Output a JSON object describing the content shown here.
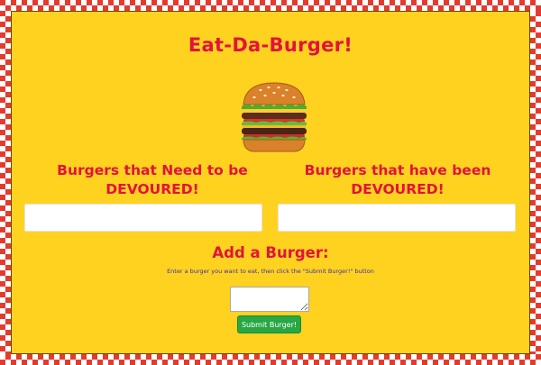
{
  "header": {
    "title": "Eat-Da-Burger!"
  },
  "image": {
    "icon": "burger-icon"
  },
  "columns": {
    "undevoured_heading": "Burgers that Need to be DEVOURED!",
    "devoured_heading": "Burgers that have been DEVOURED!"
  },
  "add_burger": {
    "heading": "Add a Burger:",
    "instructions": "Enter a burger you want to eat, then click the \"Submit Burger!\" button",
    "input_value": "",
    "submit_label": "Submit Burger!"
  },
  "colors": {
    "background": "#ffd21f",
    "heading_red": "#e3123c",
    "instruction_blue": "#3b2fb3",
    "submit_green": "#28a745",
    "border_red": "#e63a2e"
  }
}
